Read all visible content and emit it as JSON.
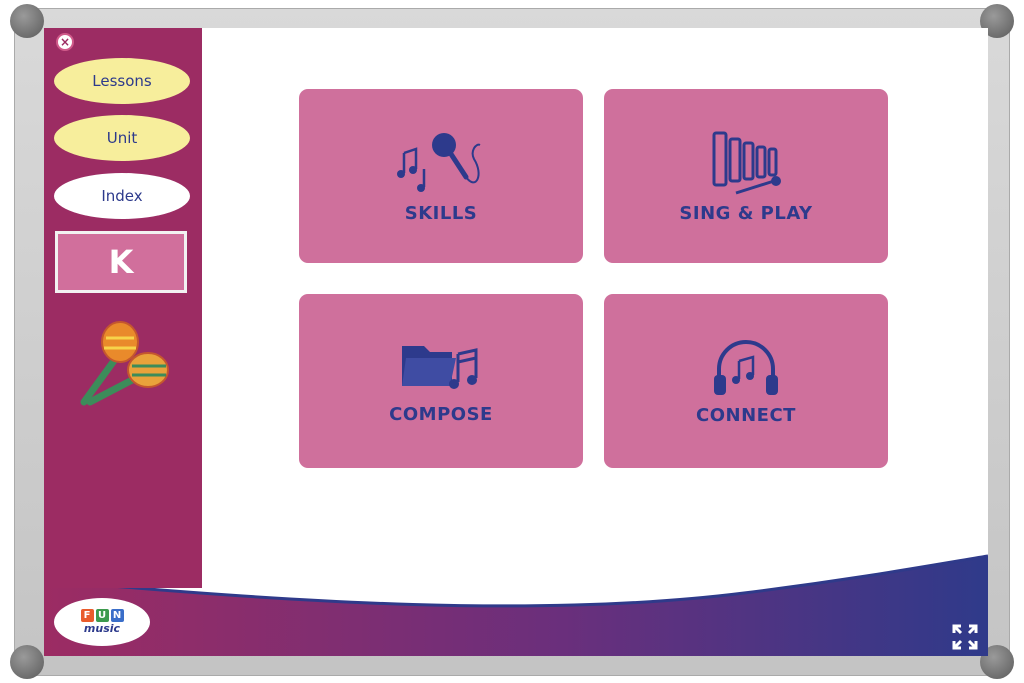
{
  "sidebar": {
    "close_label": "×",
    "buttons": [
      {
        "label": "Lessons",
        "style": "yellow"
      },
      {
        "label": "Unit",
        "style": "yellow"
      },
      {
        "label": "Index",
        "style": "white"
      }
    ],
    "grade": "K"
  },
  "cards": [
    {
      "label": "SKILLS",
      "icon": "microphone-music-icon"
    },
    {
      "label": "SING & PLAY",
      "icon": "xylophone-icon"
    },
    {
      "label": "COMPOSE",
      "icon": "folder-music-icon"
    },
    {
      "label": "CONNECT",
      "icon": "headphones-icon"
    }
  ],
  "logo": {
    "letters": [
      "F",
      "U",
      "N"
    ],
    "word": "music"
  },
  "colors": {
    "sidebar": "#9c2c63",
    "card": "#cf709c",
    "ink": "#2d3a8c",
    "wave_start": "#9c2c63",
    "wave_end": "#2f3a8a"
  }
}
